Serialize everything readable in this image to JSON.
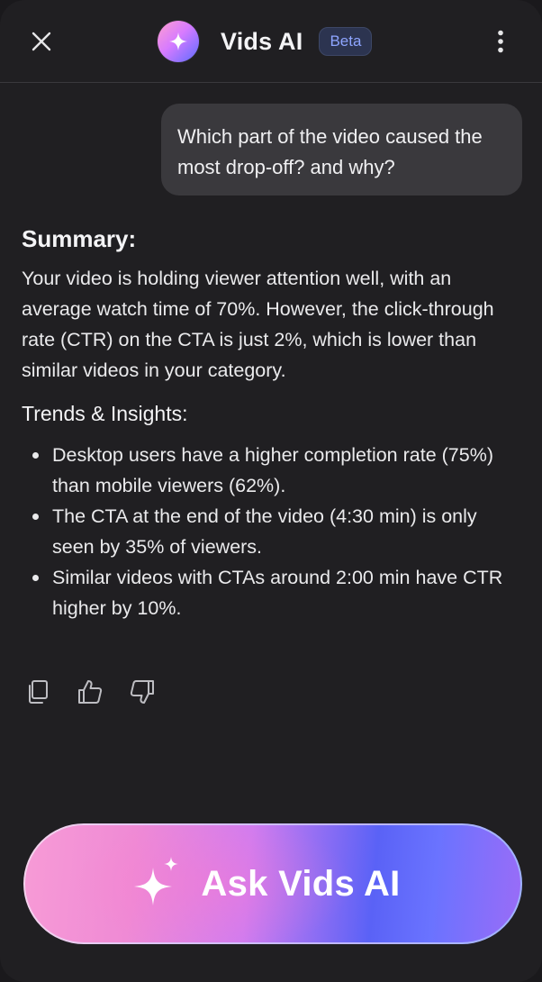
{
  "header": {
    "title": "Vids AI",
    "badge": "Beta",
    "close_icon": "close-icon",
    "logo_icon": "sparkle-icon",
    "more_icon": "more-vertical-icon"
  },
  "conversation": {
    "user_message": "Which part of the video caused the most drop-off? and why?"
  },
  "response": {
    "summary_title": "Summary:",
    "summary_text": "Your video is holding viewer attention well, with an average watch time of 70%. However, the click-through rate (CTR) on the CTA is just 2%, which is lower than similar videos in your category.",
    "insights_title": "Trends & Insights:",
    "insights": [
      "Desktop users have a higher completion rate (75%) than mobile viewers (62%).",
      "The CTA at the end of the video (4:30 min) is only seen by 35% of viewers.",
      "Similar videos with CTAs around 2:00 min have CTR higher by 10%."
    ]
  },
  "actions": {
    "copy_icon": "copy-icon",
    "like_icon": "thumbs-up-icon",
    "dislike_icon": "thumbs-down-icon"
  },
  "ask_button": {
    "label": "Ask Vids AI",
    "icon": "sparkle-icon"
  },
  "colors": {
    "background": "#201f22",
    "bubble": "#3a393d",
    "badge_text": "#8ea5ff",
    "gradient_pink": "#f79bd6",
    "gradient_blue": "#5a62f6"
  }
}
